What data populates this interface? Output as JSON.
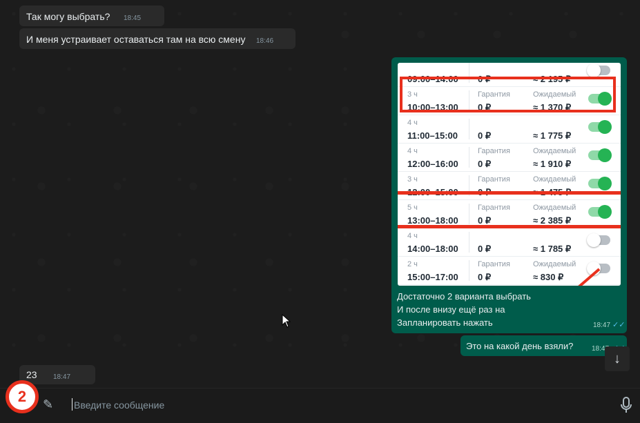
{
  "incoming_messages": [
    {
      "text": "Так могу выбрать?",
      "time": "18:45"
    },
    {
      "text": "И меня устраивает оставаться там на всю смену",
      "time": "18:46"
    },
    {
      "text": "23",
      "time": "18:47"
    }
  ],
  "shared_image": {
    "rows": [
      {
        "duration": "",
        "time": "09:00–14:00",
        "guarantee_label": "",
        "guarantee": "0 ₽",
        "expected_label": "",
        "expected": "≈ 2 195 ₽",
        "toggle_on": false
      },
      {
        "duration": "3 ч",
        "time": "10:00–13:00",
        "guarantee_label": "Гарантия",
        "guarantee": "0 ₽",
        "expected_label": "Ожидаемый",
        "expected": "≈ 1 370 ₽",
        "toggle_on": true
      },
      {
        "duration": "4 ч",
        "time": "11:00–15:00",
        "guarantee_label": "",
        "guarantee": "0 ₽",
        "expected_label": "",
        "expected": "≈ 1 775 ₽",
        "toggle_on": true
      },
      {
        "duration": "4 ч",
        "time": "12:00–16:00",
        "guarantee_label": "Гарантия",
        "guarantee": "0 ₽",
        "expected_label": "Ожидаемый",
        "expected": "≈ 1 910 ₽",
        "toggle_on": true
      },
      {
        "duration": "3 ч",
        "time": "12:00–15:00",
        "guarantee_label": "Гарантия",
        "guarantee": "0 ₽",
        "expected_label": "Ожидаемый",
        "expected": "≈ 1 475 ₽",
        "toggle_on": true
      },
      {
        "duration": "5 ч",
        "time": "13:00–18:00",
        "guarantee_label": "Гарантия",
        "guarantee": "0 ₽",
        "expected_label": "Ожидаемый",
        "expected": "≈ 2 385 ₽",
        "toggle_on": true
      },
      {
        "duration": "4 ч",
        "time": "14:00–18:00",
        "guarantee_label": "",
        "guarantee": "0 ₽",
        "expected_label": "",
        "expected": "≈ 1 785 ₽",
        "toggle_on": false
      },
      {
        "duration": "2 ч",
        "time": "15:00–17:00",
        "guarantee_label": "Гарантия",
        "guarantee": "0 ₽",
        "expected_label": "Ожидаемый",
        "expected": "≈ 830 ₽",
        "toggle_on": false
      }
    ]
  },
  "outgoing_messages": [
    {
      "lines": [
        "Достаточно 2 варианта выбрать",
        "И после внизу ещё раз на",
        "Запланировать нажать"
      ],
      "time": "18:47",
      "status": "read"
    },
    {
      "text": "Это на какой день взяли?",
      "time": "18:47",
      "status": "read"
    }
  ],
  "composer": {
    "placeholder": "Введите сообщение"
  },
  "annotations": {
    "badge_number": "2",
    "highlight_color": "#e8301d"
  },
  "colors": {
    "outgoing_bubble": "#005c4b",
    "incoming_bubble": "#2a2a2a",
    "toggle_on": "#25b354",
    "read_ticks": "#53bdeb"
  },
  "icons": {
    "attach": "paperclip-icon",
    "mic": "microphone-icon",
    "scroll": "arrow-down-icon",
    "read": "double-check-icon"
  }
}
